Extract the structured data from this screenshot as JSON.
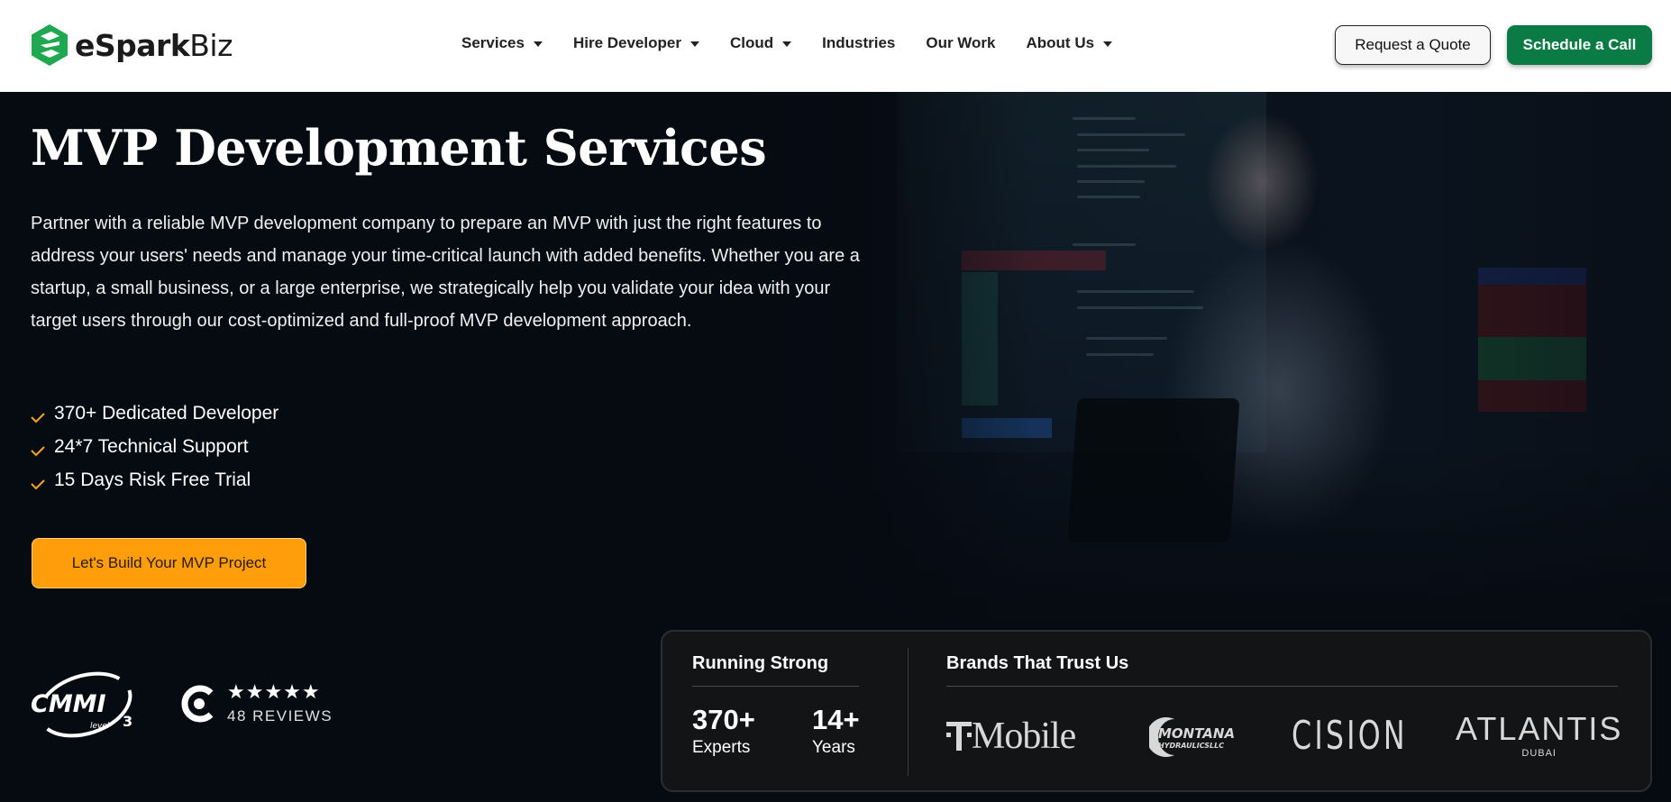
{
  "header": {
    "brand": {
      "name_bold": "eSpark",
      "name_light": "Biz",
      "brand_color": "#1fa84f"
    },
    "nav": [
      {
        "label": "Services",
        "has_dropdown": true
      },
      {
        "label": "Hire Developer",
        "has_dropdown": true
      },
      {
        "label": "Cloud",
        "has_dropdown": true
      },
      {
        "label": "Industries",
        "has_dropdown": false
      },
      {
        "label": "Our Work",
        "has_dropdown": false
      },
      {
        "label": "About Us",
        "has_dropdown": true
      }
    ],
    "request_quote_label": "Request a Quote",
    "schedule_call_label": "Schedule a Call",
    "schedule_call_color": "#0b7b45"
  },
  "hero": {
    "title": "MVP Development Services",
    "description": "Partner with a reliable MVP development company to prepare an MVP with just the right features to address your users' needs and manage your time-critical launch with added benefits. Whether you are a startup, a small business, or a large enterprise, we strategically help you validate your idea with your target users through our cost-optimized and full-proof MVP development approach.",
    "features": [
      {
        "icon": "check-icon",
        "label": "370+ Dedicated Developer"
      },
      {
        "icon": "check-icon",
        "label": "24*7 Technical Support"
      },
      {
        "icon": "check-icon",
        "label": "15 Days Risk Free Trial"
      }
    ],
    "check_color": "#f5a623",
    "cta_label": "Let's Build Your MVP Project",
    "cta_color": "#ff9d0a"
  },
  "badges": {
    "cmmi": {
      "name": "CMMI",
      "level_word": "level",
      "level_number": "3"
    },
    "clutch": {
      "rating_stars": 5,
      "stars_text": "★★★★★",
      "reviews_label": "48 REVIEWS"
    }
  },
  "stats_card": {
    "running_title": "Running Strong",
    "stats": [
      {
        "value": "370+",
        "label": "Experts"
      },
      {
        "value": "14+",
        "label": "Years"
      }
    ],
    "brands_title": "Brands That Trust Us",
    "brands": [
      {
        "name": "T Mobile",
        "text": "Mobile"
      },
      {
        "name": "Montana Hydraulics LLC",
        "line1": "MONTANA",
        "line2": "HYDRAULICSLLC"
      },
      {
        "name": "Cision",
        "text": "CISION"
      },
      {
        "name": "Atlantis Dubai",
        "line1": "ATLANTIS",
        "line2": "DUBAI"
      }
    ]
  }
}
